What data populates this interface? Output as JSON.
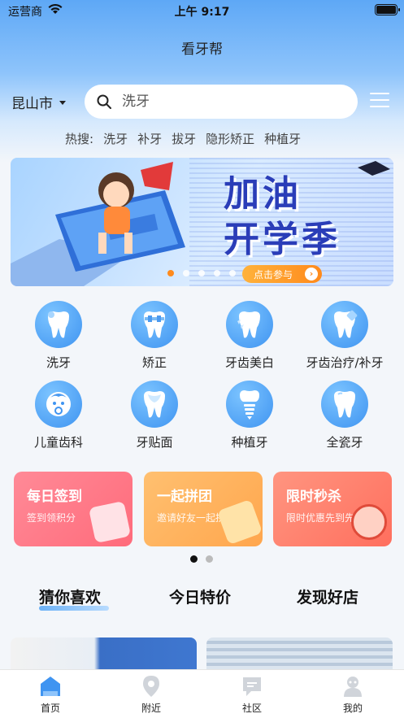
{
  "status_bar": {
    "carrier": "运营商",
    "time": "上午 9:17"
  },
  "app": {
    "title": "看牙帮"
  },
  "location": {
    "city": "昆山市"
  },
  "search": {
    "placeholder": "洗牙"
  },
  "hot_search": {
    "label": "热搜:",
    "terms": [
      "洗牙",
      "补牙",
      "拔牙",
      "隐形矫正",
      "种植牙"
    ]
  },
  "banner": {
    "title_line1": "加油",
    "title_line2": "开学季",
    "button_label": "点击参与",
    "slide_count": 5,
    "active_slide": 0
  },
  "categories": [
    {
      "label": "洗牙",
      "icon": "tooth-clean-icon"
    },
    {
      "label": "矫正",
      "icon": "tooth-braces-icon"
    },
    {
      "label": "牙齿美白",
      "icon": "tooth-whitening-icon"
    },
    {
      "label": "牙齿治疗/补牙",
      "icon": "tooth-repair-icon"
    },
    {
      "label": "儿童齿科",
      "icon": "child-face-icon"
    },
    {
      "label": "牙贴面",
      "icon": "tooth-veneer-icon"
    },
    {
      "label": "种植牙",
      "icon": "tooth-implant-icon"
    },
    {
      "label": "全瓷牙",
      "icon": "tooth-ceramic-icon"
    }
  ],
  "promos": [
    {
      "title": "每日签到",
      "subtitle": "签到领积分",
      "color": "#ff7b8a"
    },
    {
      "title": "一起拼团",
      "subtitle": "邀请好友一起拼团",
      "color": "#ffb25a"
    },
    {
      "title": "限时秒杀",
      "subtitle": "限时优惠先到先得",
      "color": "#ff7f6e"
    }
  ],
  "promo_pager": {
    "pages": 2,
    "active": 0
  },
  "feed_tabs": [
    "猜你喜欢",
    "今日特价",
    "发现好店"
  ],
  "tabbar": [
    {
      "label": "首页",
      "icon": "home-icon",
      "active": true
    },
    {
      "label": "附近",
      "icon": "location-pin-icon",
      "active": false
    },
    {
      "label": "社区",
      "icon": "chat-bubble-icon",
      "active": false
    },
    {
      "label": "我的",
      "icon": "user-icon",
      "active": false
    }
  ],
  "colors": {
    "accent": "#3f94f1",
    "header_top": "#5ea8f6",
    "background": "#f3f6fa"
  }
}
